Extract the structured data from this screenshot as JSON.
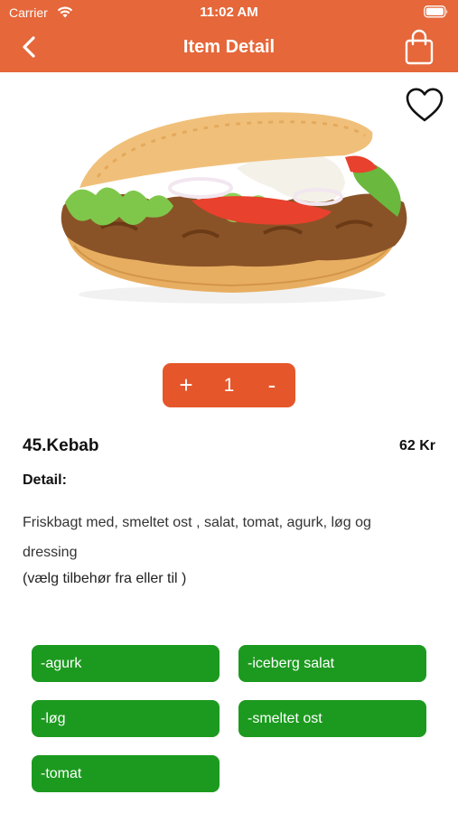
{
  "status_bar": {
    "carrier": "Carrier",
    "time": "11:02 AM"
  },
  "nav": {
    "title": "Item Detail"
  },
  "quantity": {
    "plus": "+",
    "value": "1",
    "minus": "-"
  },
  "item": {
    "name": "45.Kebab",
    "price": "62 Kr",
    "detail_heading": "Detail:",
    "description": "Friskbagt med, smeltet ost , salat, tomat, agurk, løg og dressing",
    "note": "(vælg tilbehør fra eller til )"
  },
  "options": [
    "-agurk",
    "-iceberg salat",
    "-løg",
    "-smeltet ost",
    "-tomat"
  ],
  "colors": {
    "header": "#e5673a",
    "quantity_bg": "#e5562a",
    "option_bg": "#1c9a1f"
  }
}
